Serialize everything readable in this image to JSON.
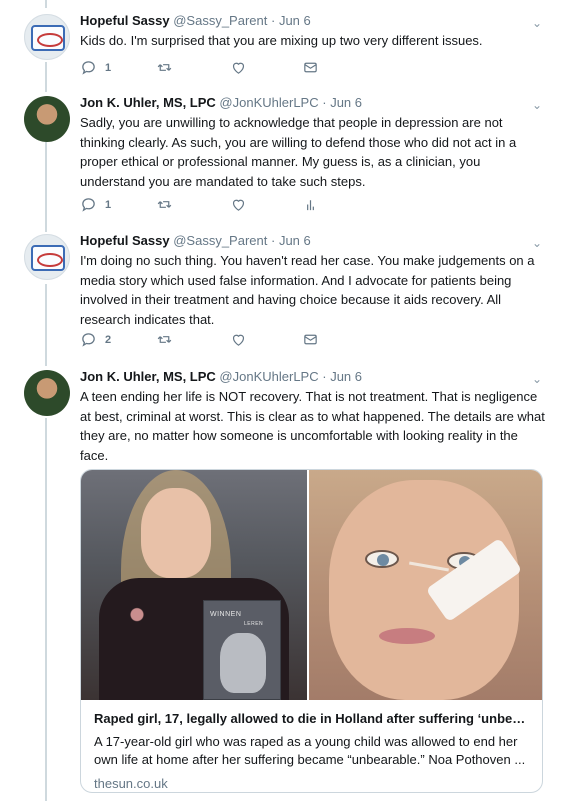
{
  "tweets": [
    {
      "name": "Hopeful Sassy",
      "handle": "@Sassy_Parent",
      "sep": "·",
      "date": "Jun 6",
      "text": "Kids do. I'm surprised that you are mixing up two very different issues.",
      "reply_count": "1",
      "avatar": "parent-logo"
    },
    {
      "name": "Jon K. Uhler, MS, LPC",
      "handle": "@JonKUhlerLPC",
      "sep": "·",
      "date": "Jun 6",
      "text": "Sadly, you are unwilling to acknowledge that people in depression are not thinking clearly. As such, you are willing to defend those who did not act in a proper ethical or professional manner. My guess is, as a clinician, you understand you are mandated to take such steps.",
      "reply_count": "1",
      "avatar": "profile-photo"
    },
    {
      "name": "Hopeful Sassy",
      "handle": "@Sassy_Parent",
      "sep": "·",
      "date": "Jun 6",
      "text": "I'm doing no such thing. You haven't read her case. You make judgements on a media story which used false information. And I advocate for patients being involved in their treatment and having choice because it aids recovery. All research indicates that.",
      "reply_count": "2",
      "avatar": "parent-logo"
    },
    {
      "name": "Jon K. Uhler, MS, LPC",
      "handle": "@JonKUhlerLPC",
      "sep": "·",
      "date": "Jun 6",
      "text": "A teen ending her life is NOT recovery. That is not treatment. That is negligence at best, criminal at worst. This is clear as to what happened. The details are what they are, no matter how someone is uncomfortable with looking reality in the face.",
      "avatar": "profile-photo"
    }
  ],
  "card": {
    "title": "Raped girl, 17, legally allowed to die in Holland after suffering ‘unbea...",
    "description": "A 17-year-old girl who was raped as a young child was allowed to end her own life at home after her suffering became “unbearable.” Noa Pothoven ...",
    "domain": "thesun.co.uk",
    "book_title": "WINNEN",
    "book_subtitle": "LEREN"
  },
  "icons": {
    "reply": "reply-icon",
    "retweet": "retweet-icon",
    "like": "heart-icon",
    "dm": "envelope-icon",
    "analytics": "analytics-icon",
    "more": "chevron-down-icon"
  },
  "colors": {
    "text": "#14171a",
    "secondary": "#657786",
    "thread_line": "#cfd9de",
    "border": "#ccd6dd"
  }
}
